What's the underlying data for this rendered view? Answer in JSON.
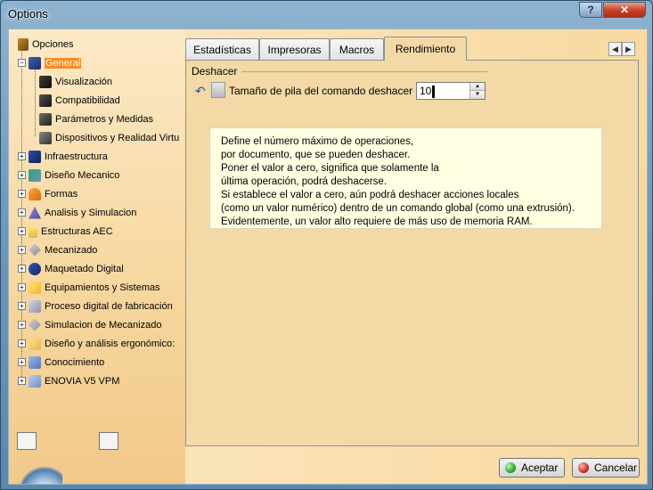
{
  "window": {
    "title": "Options",
    "help_symbol": "?",
    "close_symbol": "✕"
  },
  "tree": {
    "root": {
      "label": "Opciones",
      "icon": "options-icon"
    },
    "items": [
      {
        "label": "General",
        "icon": "general-icon",
        "selected": true
      },
      {
        "label": "Visualización",
        "icon": "display-icon"
      },
      {
        "label": "Compatibilidad",
        "icon": "compatibility-icon"
      },
      {
        "label": "Parámetros y Medidas",
        "icon": "parameters-icon"
      },
      {
        "label": "Dispositivos y Realidad Virtu",
        "icon": "devices-icon"
      },
      {
        "label": "Infraestructura",
        "icon": "infrastructure-icon"
      },
      {
        "label": "Diseño Mecanico",
        "icon": "mechanical-design-icon"
      },
      {
        "label": "Formas",
        "icon": "shapes-icon"
      },
      {
        "label": "Analisis y Simulacion",
        "icon": "analysis-icon"
      },
      {
        "label": "Estructuras AEC",
        "icon": "aec-icon"
      },
      {
        "label": "Mecanizado",
        "icon": "machining-icon"
      },
      {
        "label": "Maquetado Digital",
        "icon": "digital-mockup-icon"
      },
      {
        "label": "Equipamientos y Sistemas",
        "icon": "equipment-icon"
      },
      {
        "label": "Proceso digital de fabricación",
        "icon": "manufacturing-icon"
      },
      {
        "label": "Simulacion de Mecanizado",
        "icon": "machining-simulation-icon"
      },
      {
        "label": "Diseño y análisis ergonómico:",
        "icon": "ergonomics-icon"
      },
      {
        "label": "Conocimiento",
        "icon": "knowledge-icon"
      },
      {
        "label": "ENOVIA V5 VPM",
        "icon": "enovia-icon"
      }
    ]
  },
  "tabs": [
    {
      "label": "Estadísticas"
    },
    {
      "label": "Impresoras"
    },
    {
      "label": "Macros"
    },
    {
      "label": "Rendimiento",
      "active": true
    }
  ],
  "panel": {
    "group_title": "Deshacer",
    "undo_stack_label": "Tamaño de pila del comando deshacer",
    "undo_stack_value": "10"
  },
  "tooltip_lines": [
    "Define el número máximo de operaciones,",
    "por documento, que se pueden deshacer.",
    "Poner el valor a cero, significa que solamente la",
    "última operación, podrá deshacerse.",
    "Si establece el valor a cero, aún podrá deshacer acciones locales",
    "(como un valor numérico) dentro de un comando global (como una extrusión).",
    "Evidentemente, un valor alto requiere de más uso de memoria RAM."
  ],
  "buttons": {
    "ok": "Aceptar",
    "cancel": "Cancelar"
  },
  "colors": {
    "selection": "#ff8a1c",
    "panel_bg": "#f3d9a6",
    "tooltip_bg": "#ffffe1"
  }
}
